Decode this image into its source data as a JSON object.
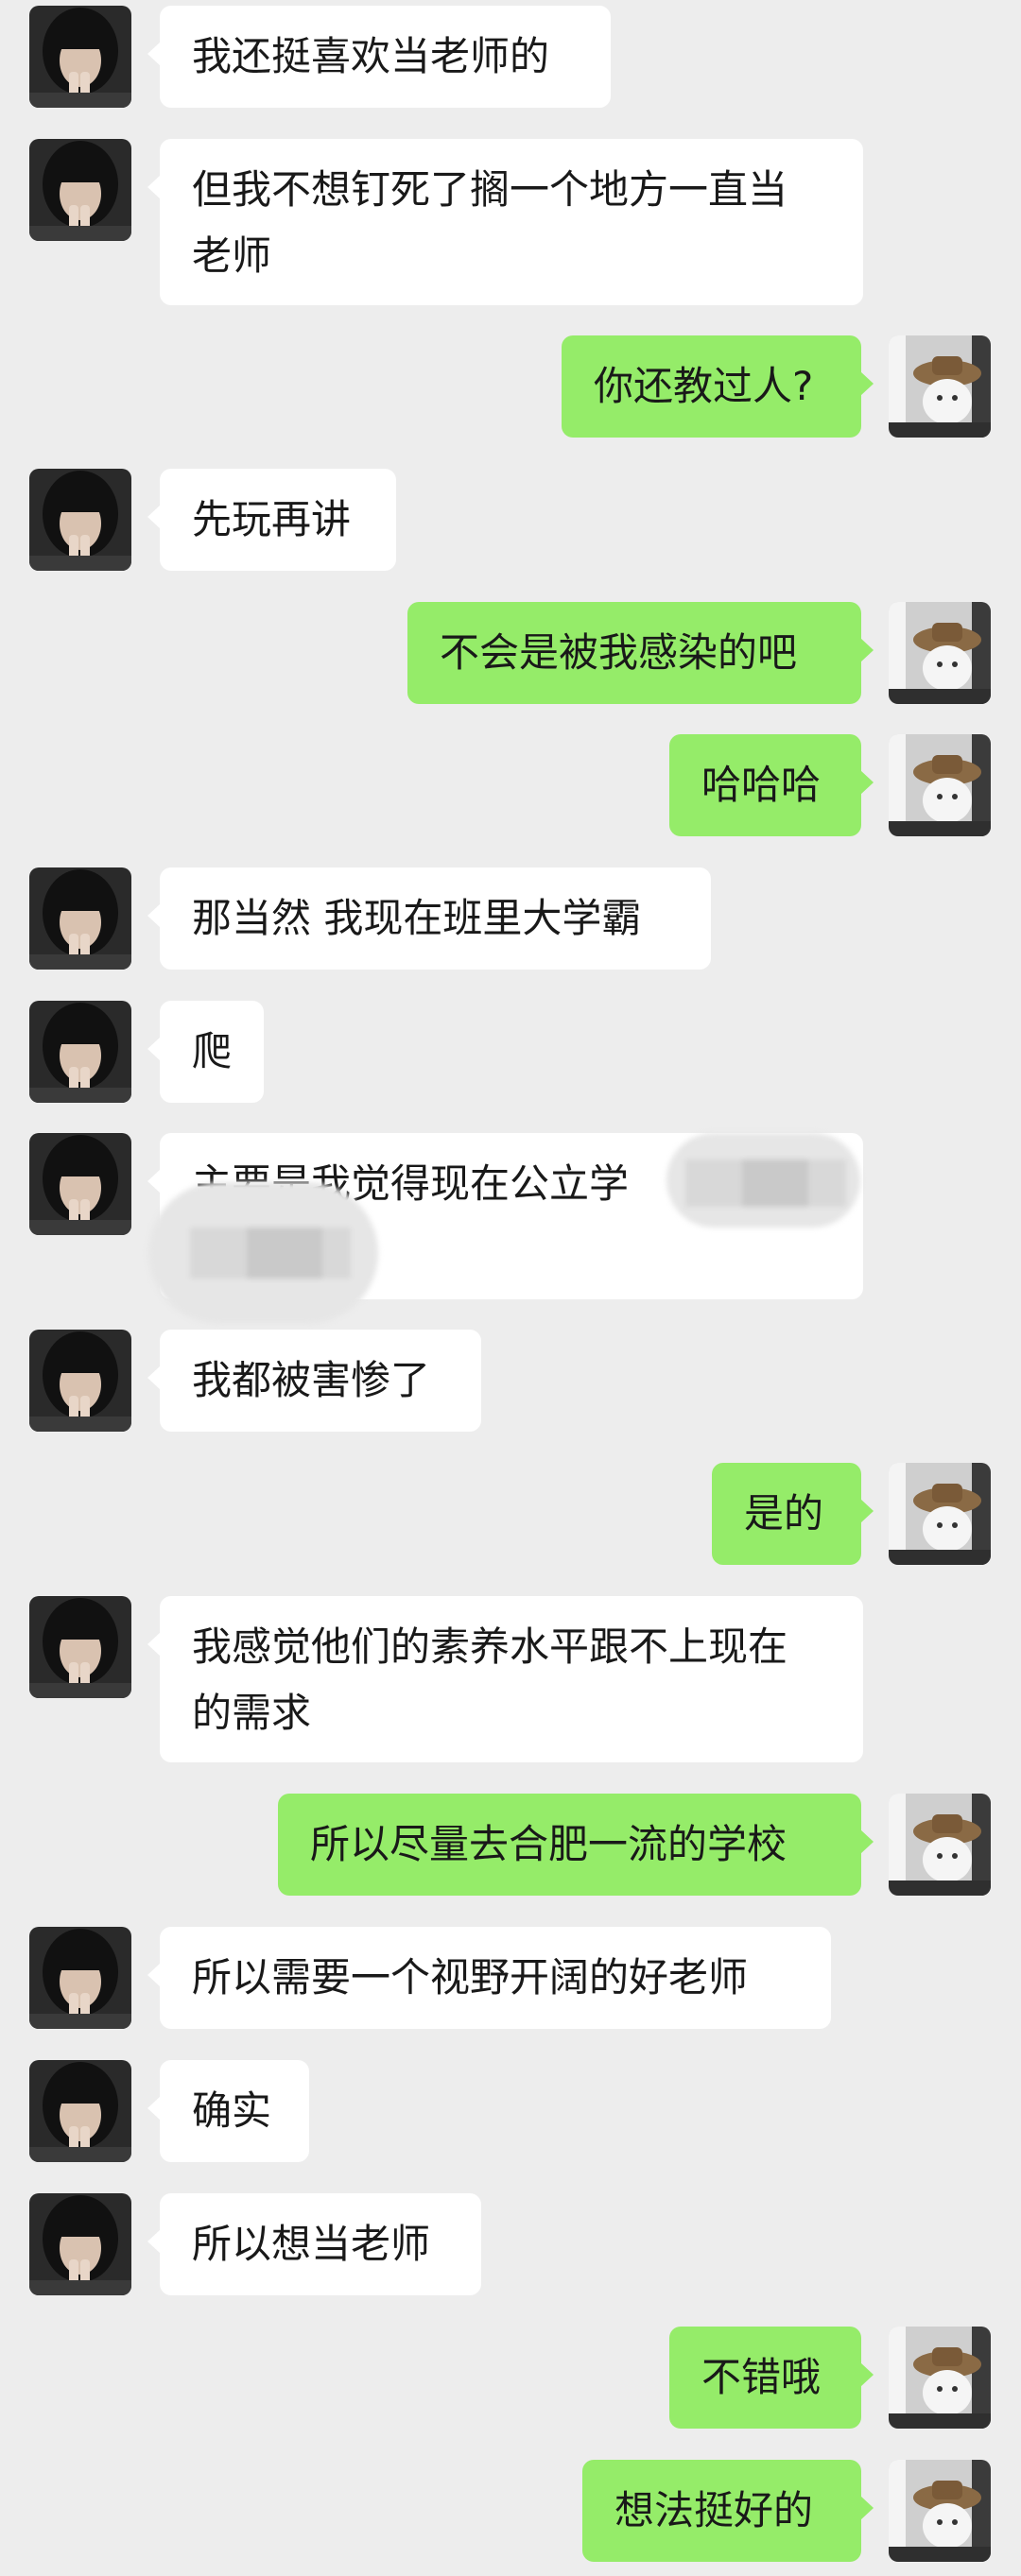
{
  "chat": {
    "messages": [
      {
        "side": "left",
        "text": "我还挺喜欢当老师的"
      },
      {
        "side": "left",
        "text": "但我不想钉死了搁一个地方一直当\n老师"
      },
      {
        "side": "right",
        "text": "你还教过人?"
      },
      {
        "side": "left",
        "text": "先玩再讲"
      },
      {
        "side": "right",
        "text": "不会是被我感染的吧"
      },
      {
        "side": "right",
        "text": "哈哈哈"
      },
      {
        "side": "left",
        "text": "那当然 我现在班里大学霸"
      },
      {
        "side": "left",
        "text": "爬"
      },
      {
        "side": "left",
        "text": "主要是我觉得现在公立学"
      },
      {
        "side": "left",
        "text": "我都被害惨了"
      },
      {
        "side": "right",
        "text": "是的"
      },
      {
        "side": "left",
        "text": "我感觉他们的素养水平跟不上现在\n的需求"
      },
      {
        "side": "right",
        "text": "所以尽量去合肥一流的学校"
      },
      {
        "side": "left",
        "text": "所以需要一个视野开阔的好老师"
      },
      {
        "side": "left",
        "text": "确实"
      },
      {
        "side": "left",
        "text": "所以想当老师"
      },
      {
        "side": "right",
        "text": "不错哦"
      },
      {
        "side": "right",
        "text": "想法挺好的"
      }
    ]
  },
  "colors": {
    "background": "#ededed",
    "received_bubble": "#ffffff",
    "sent_bubble": "#95ec69",
    "text": "#191919"
  },
  "icons": {
    "left_avatar": "girl-hands-avatar",
    "right_avatar": "cat-with-hat-avatar"
  }
}
